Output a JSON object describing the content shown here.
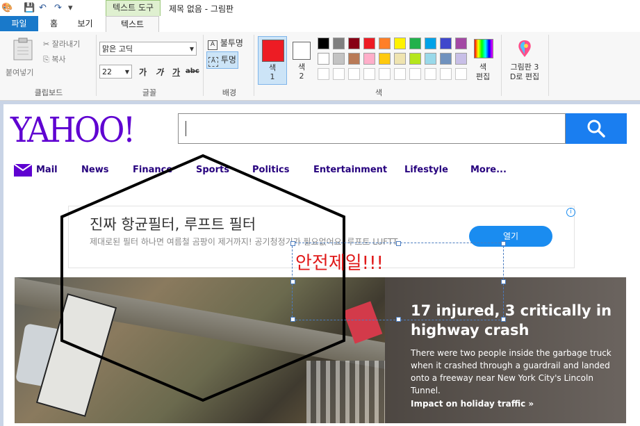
{
  "app": {
    "title": "제목 없음 - 그림판",
    "context_tab": "텍스트 도구",
    "tabs": [
      "파일",
      "홈",
      "보기",
      "텍스트"
    ]
  },
  "ribbon": {
    "clipboard": {
      "paste": "붙여넣기",
      "cut": "잘라내기",
      "copy": "복사",
      "label": "클립보드"
    },
    "font": {
      "family": "맑은 고딕",
      "size": "22",
      "bold": "가",
      "italic": "가",
      "underline": "가",
      "strike": "abc",
      "label": "글꼴"
    },
    "background": {
      "opaque": "불투명",
      "transparent": "투명",
      "label": "배경"
    },
    "colors": {
      "color1": "색\n1",
      "color2": "색\n2",
      "edit": "색\n편집",
      "paint3d": "그림판 3\nD로 편집",
      "label": "색",
      "active_color": "#ed1c24",
      "palette_row1": [
        "#000000",
        "#7f7f7f",
        "#880015",
        "#ed1c24",
        "#ff7f27",
        "#fff200",
        "#22b14c",
        "#00a2e8",
        "#3f48cc",
        "#a349a4"
      ],
      "palette_row2": [
        "#ffffff",
        "#c3c3c3",
        "#b97a57",
        "#ffaec9",
        "#ffc90e",
        "#efe4b0",
        "#b5e61d",
        "#99d9ea",
        "#7092be",
        "#c8bfe7"
      ]
    }
  },
  "yahoo": {
    "logo": "YAHOO!",
    "nav": [
      "Mail",
      "News",
      "Finance",
      "Sports",
      "Politics",
      "Entertainment",
      "Lifestyle",
      "More..."
    ],
    "ad": {
      "title": "진짜 항균필터, 루프트 필터",
      "desc": "제대로된 필터 하나면 여름철 곰팡이 제거까지! 공기청정기가 필요없어요. 루프트 LUFTT",
      "button": "열기"
    },
    "story": {
      "title": "17 injured, 3 critically in highway crash",
      "text": "There were two people inside the garbage truck when it crashed through a guardrail and landed onto a freeway near New York City's Lincoln Tunnel.",
      "link": "Impact on holiday traffic »"
    }
  },
  "overlay": {
    "text": "안전제일!!!"
  }
}
